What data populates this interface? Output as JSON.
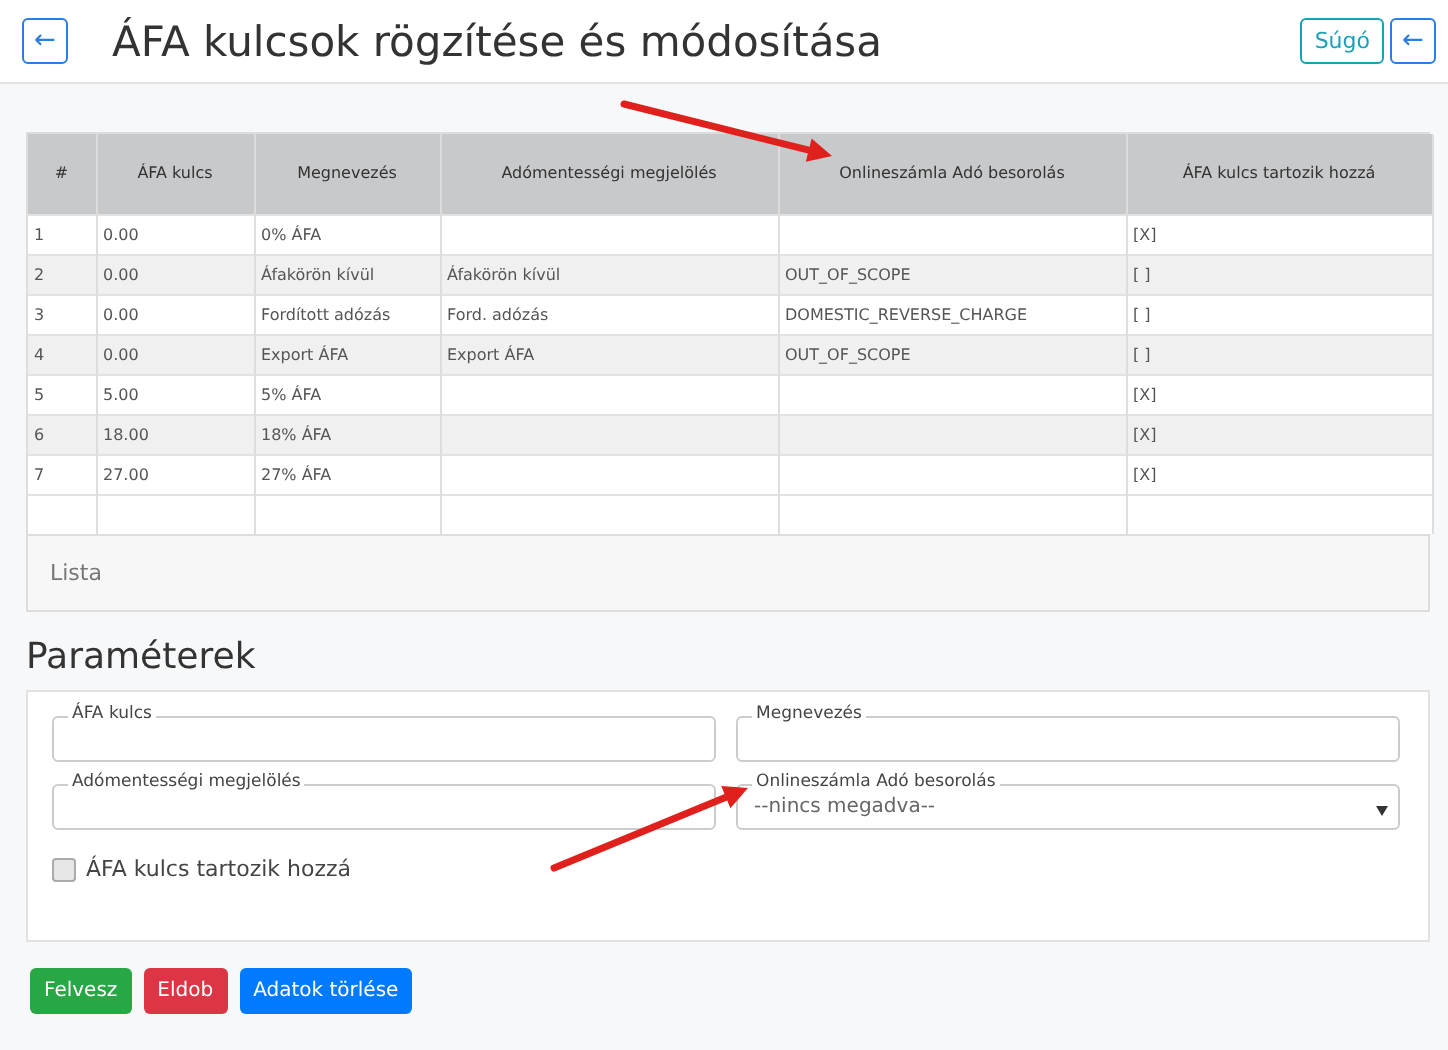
{
  "header": {
    "back_button": "←",
    "title": "ÁFA kulcsok rögzítése és módosítása",
    "help_button": "Súgó",
    "return_button": "←"
  },
  "table": {
    "columns": [
      "#",
      "ÁFA kulcs",
      "Megnevezés",
      "Adómentességi megjelölés",
      "Onlineszámla Adó besorolás",
      "ÁFA kulcs tartozik hozzá"
    ],
    "rows": [
      [
        "1",
        "0.00",
        "0% ÁFA",
        "",
        "",
        "[X]"
      ],
      [
        "2",
        "0.00",
        "Áfakörön kívül",
        "Áfakörön kívül",
        "OUT_OF_SCOPE",
        "[ ]"
      ],
      [
        "3",
        "0.00",
        "Fordított adózás",
        "Ford. adózás",
        "DOMESTIC_REVERSE_CHARGE",
        "[ ]"
      ],
      [
        "4",
        "0.00",
        "Export ÁFA",
        "Export ÁFA",
        "OUT_OF_SCOPE",
        "[ ]"
      ],
      [
        "5",
        "5.00",
        "5% ÁFA",
        "",
        "",
        "[X]"
      ],
      [
        "6",
        "18.00",
        "18% ÁFA",
        "",
        "",
        "[X]"
      ],
      [
        "7",
        "27.00",
        "27% ÁFA",
        "",
        "",
        "[X]"
      ]
    ],
    "footer": "Lista"
  },
  "parameters": {
    "title": "Paraméterek",
    "fields": [
      {
        "kind": "input",
        "label": "ÁFA kulcs"
      },
      {
        "kind": "input",
        "label": "Megnevezés"
      },
      {
        "kind": "input",
        "label": "Adómentességi megjelölés"
      },
      {
        "kind": "select",
        "label": "Onlineszámla Adó besorolás",
        "value": "--nincs megadva--"
      }
    ],
    "checkbox": {
      "label": "ÁFA kulcs tartozik hozzá",
      "checked": false
    }
  },
  "buttons": [
    {
      "label": "Felvesz",
      "color": "#28a745"
    },
    {
      "label": "Eldob",
      "color": "#dc3545"
    },
    {
      "label": "Adatok törlése",
      "color": "#007bff"
    }
  ]
}
